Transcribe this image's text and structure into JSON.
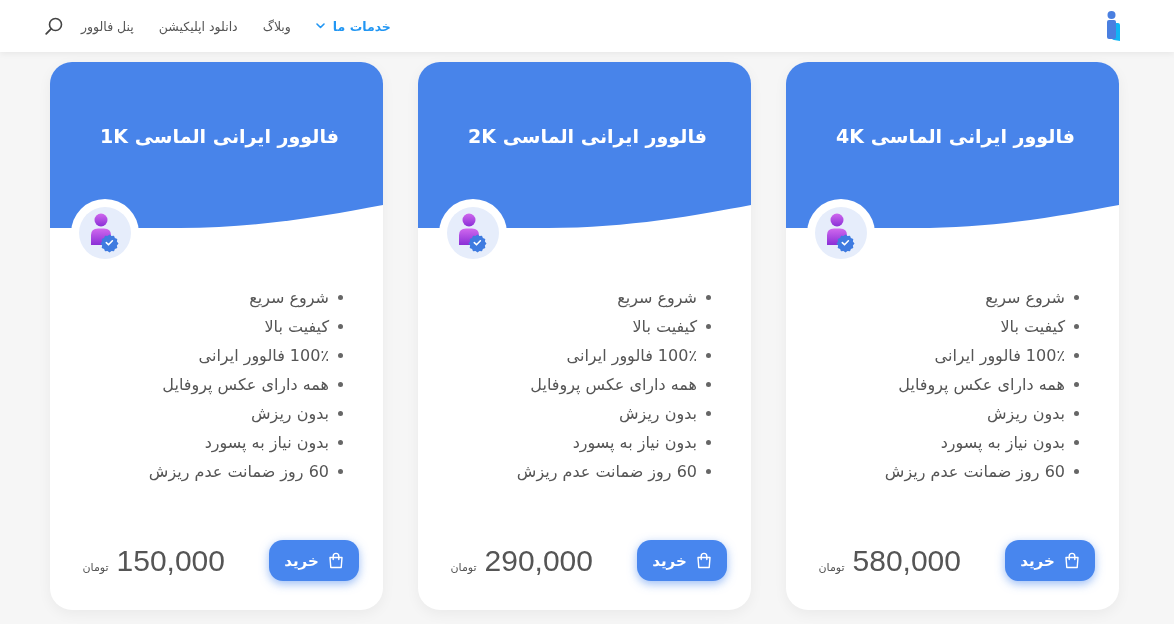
{
  "header": {
    "nav": [
      {
        "label": "خدمات ما",
        "kind": "dropdown",
        "selected": true
      },
      {
        "label": "وبلاگ",
        "kind": "link",
        "selected": false
      },
      {
        "label": "دانلود اپلیکیشن",
        "kind": "link",
        "selected": false
      },
      {
        "label": "پنل فالوور",
        "kind": "link",
        "selected": false
      }
    ]
  },
  "cards": [
    {
      "title": "فالوور ایرانی الماسی 4K",
      "features": [
        "شروع سریع",
        "کیفیت بالا",
        "100٪ فالوور ایرانی",
        "همه دارای عکس پروفایل",
        "بدون ریزش",
        "بدون نیاز به پسورد",
        "60 روز ضمانت عدم ریزش"
      ],
      "button": "خرید",
      "price": "580,000",
      "currency": "تومان"
    },
    {
      "title": "فالوور ایرانی الماسی 2K",
      "features": [
        "شروع سریع",
        "کیفیت بالا",
        "100٪ فالوور ایرانی",
        "همه دارای عکس پروفایل",
        "بدون ریزش",
        "بدون نیاز به پسورد",
        "60 روز ضمانت عدم ریزش"
      ],
      "button": "خرید",
      "price": "290,000",
      "currency": "تومان"
    },
    {
      "title": "فالوور ایرانی الماسی 1K",
      "features": [
        "شروع سریع",
        "کیفیت بالا",
        "100٪ فالوور ایرانی",
        "همه دارای عکس پروفایل",
        "بدون ریزش",
        "بدون نیاز به پسورد",
        "60 روز ضمانت عدم ریزش"
      ],
      "button": "خرید",
      "price": "150,000",
      "currency": "تومان"
    }
  ]
}
